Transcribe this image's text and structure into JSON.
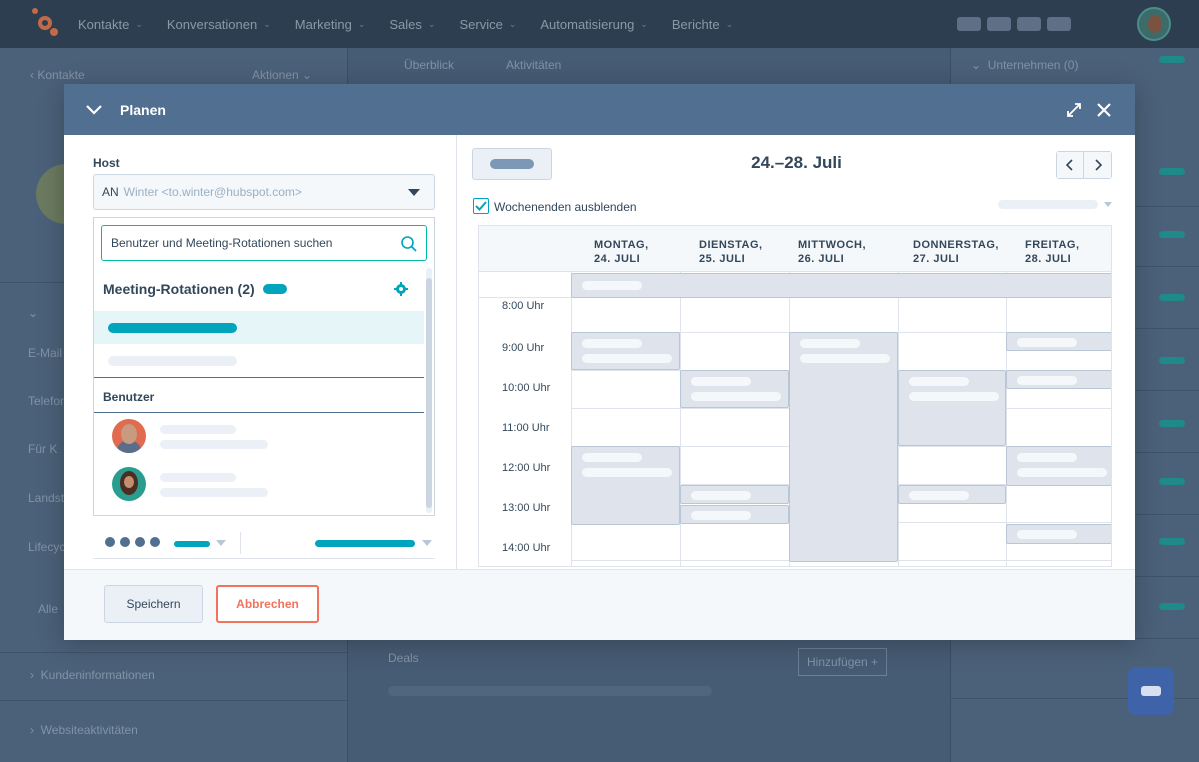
{
  "nav": {
    "items": [
      "Kontakte",
      "Konversationen",
      "Marketing",
      "Sales",
      "Service",
      "Automatisierung",
      "Berichte"
    ]
  },
  "background": {
    "back_link": "Kontakte",
    "actions": "Aktionen",
    "tab_overview": "Überblick",
    "tab_activities": "Aktivitäten",
    "companies": "Unternehmen (0)",
    "field_email": "E-Mail",
    "field_phone": "Telefon",
    "field_for": "Für K",
    "field_country": "Landst",
    "field_lifecycle": "Lifecyc",
    "all_label": "Alle",
    "customer_info": "Kundeninformationen",
    "website_activity": "Websiteaktivitäten",
    "deals": "Deals",
    "add_button": "Hinzufügen +"
  },
  "modal": {
    "title": "Planen",
    "host_label": "Host",
    "host_initials": "AN",
    "host_value": "Winter <to.winter@hubspot.com>",
    "search_placeholder": "Benutzer und Meeting-Rotationen suchen",
    "rotations_header": "Meeting-Rotationen (2)",
    "users_header": "Benutzer",
    "save_label": "Speichern",
    "cancel_label": "Abbrechen"
  },
  "calendar": {
    "date_range": "24.–28. Juli",
    "hide_weekends_label": "Wochenenden ausblenden",
    "hide_weekends_checked": true,
    "days": [
      {
        "name": "MONTAG,",
        "date": "24. JULI"
      },
      {
        "name": "DIENSTAG,",
        "date": "25. JULI"
      },
      {
        "name": "MITTWOCH,",
        "date": "26. JULI"
      },
      {
        "name": "DONNERSTAG,",
        "date": "27. JULI"
      },
      {
        "name": "FREITAG,",
        "date": "28. JULI"
      }
    ],
    "times": [
      "8:00 Uhr",
      "9:00 Uhr",
      "10:00 Uhr",
      "11:00 Uhr",
      "12:00 Uhr",
      "13:00 Uhr",
      "14:00 Uhr"
    ]
  },
  "colors": {
    "accent_teal": "#00a4bd",
    "cancel_orange": "#f2735b",
    "header_blue": "#516f90"
  }
}
